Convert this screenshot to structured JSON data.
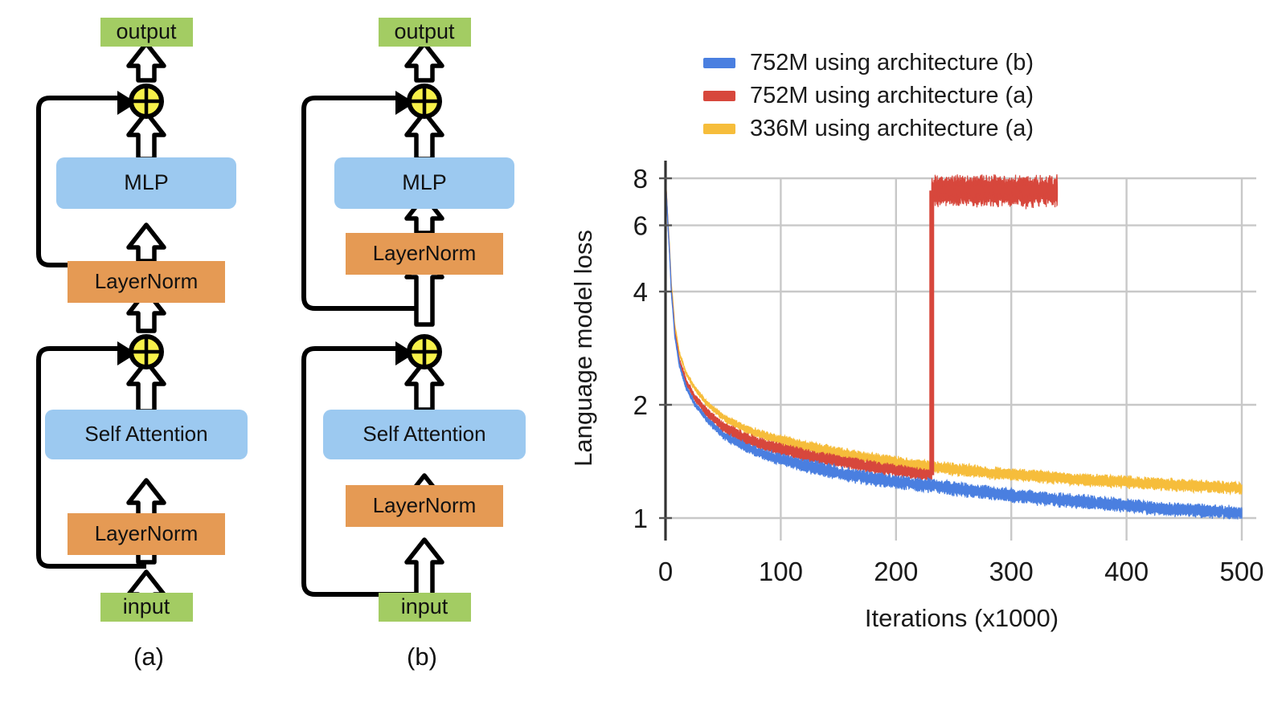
{
  "figure": {
    "diagrams": [
      {
        "caption": "(a)",
        "nodes": {
          "output": "output",
          "mlp": "MLP",
          "layernorm_top": "LayerNorm",
          "self_attention": "Self Attention",
          "layernorm_bottom": "LayerNorm",
          "input": "input",
          "add_top": "+",
          "add_bottom": "+"
        }
      },
      {
        "caption": "(b)",
        "nodes": {
          "output": "output",
          "mlp": "MLP",
          "layernorm_top": "LayerNorm",
          "self_attention": "Self Attention",
          "layernorm_bottom": "LayerNorm",
          "input": "input",
          "add_top": "+",
          "add_bottom": "+"
        }
      }
    ],
    "colors": {
      "box_green": "#A3CC63",
      "box_blue": "#9CC9F0",
      "box_orange": "#E59A54",
      "node_yellow": "#F7F14A",
      "outline_black": "#000000",
      "series_blue": "#4A7FE0",
      "series_red": "#D7473C",
      "series_yellow": "#F6BD3B",
      "gridline": "#C8C8C8",
      "axis": "#4d4d4d"
    }
  },
  "chart_data": {
    "type": "line",
    "title": "",
    "xlabel": "Iterations (x1000)",
    "ylabel": "Language model loss",
    "yscale": "log",
    "xlim": [
      0,
      500
    ],
    "ylim": [
      0.92,
      8.3
    ],
    "xticks": [
      "0",
      "100",
      "200",
      "300",
      "400",
      "500"
    ],
    "xtick_values": [
      0,
      100,
      200,
      300,
      400,
      500
    ],
    "yticks": [
      "1",
      "2",
      "4",
      "6",
      "8"
    ],
    "ytick_values": [
      1,
      2,
      4,
      6,
      8
    ],
    "grid": true,
    "legend_position": "above-plot",
    "series": [
      {
        "name": "752M using architecture (b)",
        "color": "#4A7FE0",
        "x": [
          0,
          2,
          5,
          8,
          12,
          18,
          25,
          35,
          50,
          70,
          90,
          110,
          130,
          160,
          190,
          220,
          250,
          280,
          310,
          340,
          370,
          400,
          430,
          460,
          500
        ],
        "values": [
          7.95,
          6.1,
          4.0,
          3.05,
          2.55,
          2.22,
          2.02,
          1.84,
          1.66,
          1.54,
          1.46,
          1.41,
          1.36,
          1.3,
          1.26,
          1.23,
          1.2,
          1.17,
          1.14,
          1.12,
          1.1,
          1.08,
          1.06,
          1.05,
          1.03
        ],
        "noise": 0.045,
        "end_x": 500
      },
      {
        "name": "752M using architecture (a)",
        "color": "#D7473C",
        "x": [
          0,
          2,
          5,
          8,
          12,
          18,
          25,
          35,
          50,
          70,
          90,
          110,
          130,
          160,
          190,
          215,
          231
        ],
        "values": [
          7.95,
          6.15,
          4.05,
          3.12,
          2.62,
          2.3,
          2.1,
          1.92,
          1.74,
          1.62,
          1.55,
          1.5,
          1.45,
          1.4,
          1.35,
          1.32,
          1.3
        ],
        "noise": 0.04,
        "divergence": {
          "x": 231,
          "loss_after": 7.42,
          "end_x": 340,
          "noise": 0.1
        }
      },
      {
        "name": "336M using architecture (a)",
        "color": "#F6BD3B",
        "x": [
          0,
          2,
          5,
          8,
          12,
          18,
          25,
          35,
          50,
          70,
          90,
          110,
          130,
          160,
          190,
          220,
          250,
          280,
          310,
          340,
          370,
          400,
          430,
          460,
          500
        ],
        "values": [
          8.0,
          6.25,
          4.2,
          3.25,
          2.74,
          2.42,
          2.22,
          2.03,
          1.85,
          1.72,
          1.64,
          1.58,
          1.53,
          1.47,
          1.42,
          1.38,
          1.35,
          1.32,
          1.3,
          1.28,
          1.26,
          1.25,
          1.23,
          1.22,
          1.2
        ],
        "noise": 0.04,
        "end_x": 500
      }
    ]
  }
}
